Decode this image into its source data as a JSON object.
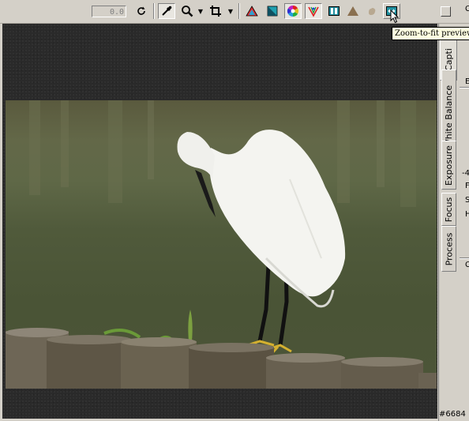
{
  "toolbar": {
    "zoom_value": "0.0",
    "buttons": [
      {
        "name": "rotate-icon"
      },
      {
        "name": "eyedropper-icon"
      },
      {
        "name": "zoom-icon"
      },
      {
        "name": "crop-icon"
      },
      {
        "name": "shadows-highlights-icon"
      },
      {
        "name": "contrast-icon"
      },
      {
        "name": "color-wheel-icon"
      },
      {
        "name": "rgb-curve-icon"
      },
      {
        "name": "split-view-icon"
      },
      {
        "name": "mountain-icon"
      },
      {
        "name": "hand-icon"
      },
      {
        "name": "zoom-to-fit-icon"
      }
    ]
  },
  "tooltip": {
    "text": "Zoom-to-fit preview"
  },
  "right_panel": {
    "tabs": [
      {
        "label": "Capti"
      },
      {
        "label": "White Balance"
      },
      {
        "label": "Exposure"
      },
      {
        "label": "Focus"
      },
      {
        "label": "Process"
      }
    ],
    "side_letters": [
      "C",
      "E",
      "-4",
      "F",
      "S",
      "H",
      "C"
    ]
  },
  "status": {
    "frame_number": "#6684"
  },
  "colors": {
    "chrome": "#d4d0c8",
    "preview_bg": "#2a2a2a",
    "tooltip_bg": "#ffffe1"
  }
}
